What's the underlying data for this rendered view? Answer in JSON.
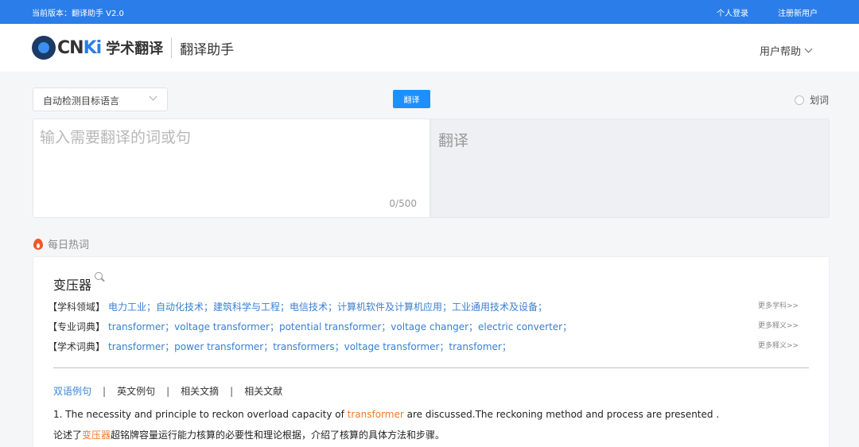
{
  "topbar": {
    "version": "当前版本：翻译助手 V2.0",
    "login": "个人登录",
    "register": "注册新用户"
  },
  "header": {
    "logo_text_prefix": "CN",
    "logo_text_i": "Ki",
    "logo_name": "学术翻译",
    "subtitle": "翻译助手",
    "help": "用户帮助"
  },
  "toolbar": {
    "language": "自动检测目标语言",
    "translate_button": "翻译",
    "huaci": "划词"
  },
  "input": {
    "placeholder": "输入需要翻译的词或句",
    "counter": "0/500"
  },
  "output": {
    "placeholder": "翻译"
  },
  "hot": {
    "title": "每日热词"
  },
  "card": {
    "word": "变压器",
    "rows": [
      {
        "label": "【学科领域】",
        "values": "电力工业；自动化技术；建筑科学与工程；电信技术；计算机软件及计算机应用；工业通用技术及设备；",
        "more": "更多学科>>"
      },
      {
        "label": "【专业词典】",
        "values": "transformer；voltage transformer；potential transformer；voltage changer；electric converter；",
        "more": "更多释义>>"
      },
      {
        "label": "【学术词典】",
        "values": "transformer；power transformer；transformers；voltage transformer；transfomer；",
        "more": "更多释义>>"
      }
    ],
    "tabs": [
      "双语例句",
      "英文例句",
      "相关文摘",
      "相关文献"
    ],
    "tab_separator": "|",
    "example": {
      "en_before": "1. The necessity and principle to reckon overload capacity of ",
      "en_highlight": "transformer",
      "en_after": " are discussed.The reckoning method and process are presented .",
      "zh_before": "论述了",
      "zh_highlight": "变压器",
      "zh_after": "超铭牌容量运行能力核算的必要性和理论根据，介绍了核算的具体方法和步骤。"
    }
  },
  "colors": {
    "topbar": "#2b7de9",
    "button": "#1e8fff",
    "link": "#3a7fd0",
    "highlight": "#f07a2c"
  }
}
